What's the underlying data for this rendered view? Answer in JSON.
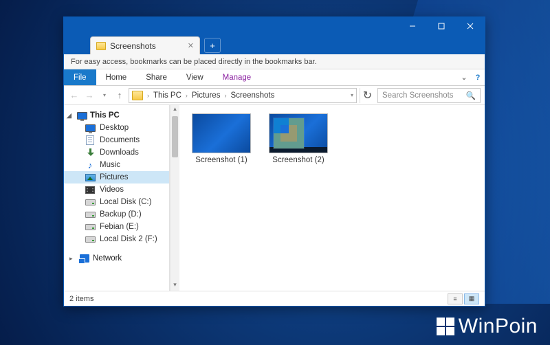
{
  "watermark": "WinPoin",
  "window": {
    "tab_title": "Screenshots",
    "bookmark_hint": "For easy access, bookmarks can be placed directly in the bookmarks bar.",
    "ribbon": {
      "file": "File",
      "tabs": [
        "Home",
        "Share",
        "View"
      ],
      "contextual": "Manage"
    },
    "address": {
      "crumbs": [
        "This PC",
        "Pictures",
        "Screenshots"
      ]
    },
    "search": {
      "placeholder": "Search Screenshots"
    },
    "nav": {
      "thispc": {
        "label": "This PC",
        "children": [
          {
            "label": "Desktop",
            "icon": "desktop"
          },
          {
            "label": "Documents",
            "icon": "doc"
          },
          {
            "label": "Downloads",
            "icon": "dl"
          },
          {
            "label": "Music",
            "icon": "music"
          },
          {
            "label": "Pictures",
            "icon": "pic",
            "selected": true
          },
          {
            "label": "Videos",
            "icon": "vid"
          },
          {
            "label": "Local Disk (C:)",
            "icon": "drive"
          },
          {
            "label": "Backup (D:)",
            "icon": "drive"
          },
          {
            "label": "Febian (E:)",
            "icon": "drive"
          },
          {
            "label": "Local Disk 2 (F:)",
            "icon": "drive"
          }
        ]
      },
      "network": {
        "label": "Network"
      }
    },
    "files": [
      {
        "name": "Screenshot (1)",
        "variant": 1
      },
      {
        "name": "Screenshot (2)",
        "variant": 2
      }
    ],
    "status": "2 items"
  }
}
